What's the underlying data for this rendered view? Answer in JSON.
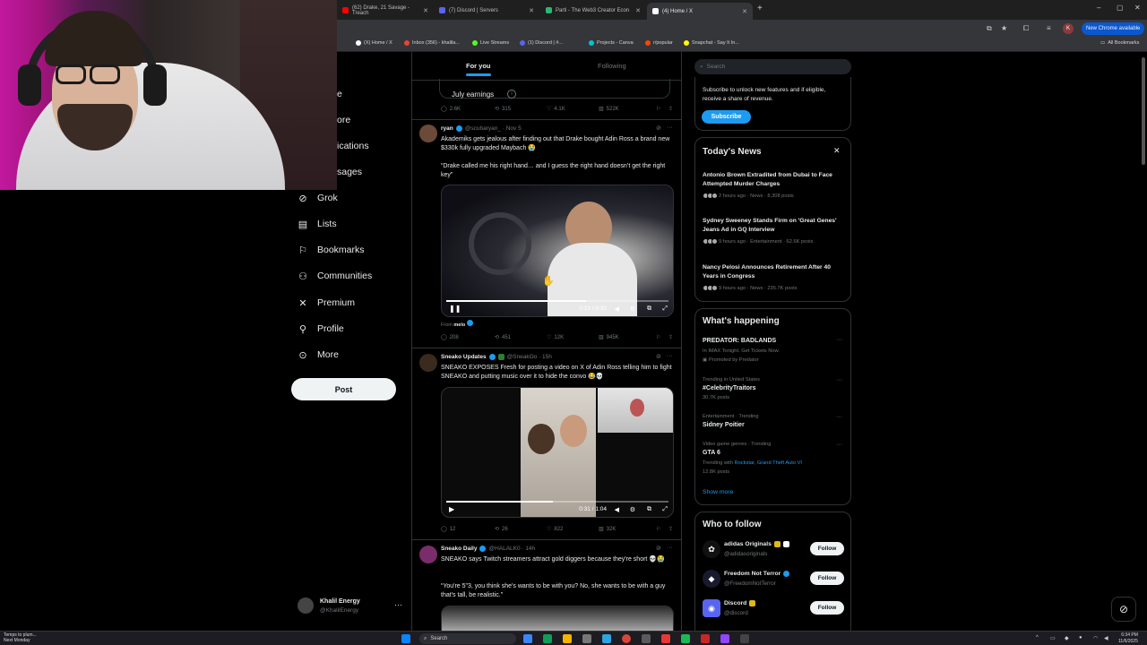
{
  "browser": {
    "tabs": [
      {
        "label": "(62) Drake, 21 Savage - Treach",
        "color": "#ff0000"
      },
      {
        "label": "(7) Discord | Servers",
        "color": "#5865f2"
      },
      {
        "label": "Parti - The Web3 Creator Econ",
        "color": "#2bb673"
      },
      {
        "label": "(4) Home / X",
        "color": "#ffffff"
      }
    ],
    "new_chrome": "New Chrome available",
    "profile_initial": "K",
    "bookmarks": [
      {
        "label": "",
        "color": "#888"
      },
      {
        "label": "(X) Home / X",
        "color": "#ffffff"
      },
      {
        "label": "Inbox (356) - khalila...",
        "color": "#ea4335"
      },
      {
        "label": "Live Streams",
        "color": "#53fc18"
      },
      {
        "label": "(1) Discord | #...",
        "color": "#5865f2"
      },
      {
        "label": "Projects - Canva",
        "color": "#00c4cc"
      },
      {
        "label": "r/popular",
        "color": "#ff4500"
      },
      {
        "label": "Snapchat - Say It In...",
        "color": "#fffc00"
      }
    ],
    "all_bookmarks": "All Bookmarks"
  },
  "nav": {
    "partials": [
      "e",
      "ore",
      "ications",
      "sages"
    ],
    "items": [
      {
        "label": "Grok",
        "icon": "grok-icon",
        "glyph": "⊘"
      },
      {
        "label": "Lists",
        "icon": "list-icon",
        "glyph": "▤"
      },
      {
        "label": "Bookmarks",
        "icon": "bookmark-icon",
        "glyph": "⚐"
      },
      {
        "label": "Communities",
        "icon": "communities-icon",
        "glyph": "⚇"
      },
      {
        "label": "Premium",
        "icon": "x-logo-icon",
        "glyph": "✕"
      },
      {
        "label": "Profile",
        "icon": "profile-icon",
        "glyph": "⚲"
      },
      {
        "label": "More",
        "icon": "more-icon",
        "glyph": "⊙"
      }
    ],
    "post_label": "Post",
    "account": {
      "name": "Khalil Energy",
      "handle": "@KhalilEnergy"
    }
  },
  "feed": {
    "tabs": {
      "for_you": "For you",
      "following": "Following"
    },
    "earnings": {
      "label": "July earnings",
      "replies": "2.6K",
      "reposts": "315",
      "likes": "4.1K",
      "views": "522K"
    },
    "posts": [
      {
        "name": "ryan",
        "handle": "@scubaryan_ · Nov 5",
        "text": "Akademiks gets jealous after finding out that Drake bought Adin Ross a brand new $330k fully upgraded Maybach 😭",
        "quote": "“Drake called me his right hand… and I guess the right hand doesn’t get the right key”",
        "video_time": "0:19 / 0:30",
        "progress": 0.63,
        "from_label": "From",
        "from_name": "melo",
        "replies": "208",
        "reposts": "451",
        "likes": "12K",
        "views": "945K"
      },
      {
        "name": "Sneako Updates",
        "handle": "@SneakOo · 15h",
        "text": "SNEAKO EXPOSES Fresh for posting a video on X of Adin Ross telling him to fight SNEAKO and putting music over it to hide the convo 😂💀",
        "video_time": "0:31 / 1:04",
        "progress": 0.48,
        "replies": "12",
        "reposts": "26",
        "likes": "822",
        "views": "32K"
      },
      {
        "name": "Sneako Daily",
        "handle": "@HALALK0 · 14h",
        "text": "SNEAKO says Twitch streamers attract gold diggers because they're short 💀😭",
        "quote": "“You're 5\"3, you think she's wants to be with you? No, she wants to be with a guy that's tall, be realistic.”"
      }
    ]
  },
  "right": {
    "search_placeholder": "Search",
    "subscribe": {
      "text": "Subscribe to unlock new features and if eligible, receive a share of revenue.",
      "button": "Subscribe"
    },
    "news_title": "Today's News",
    "news": [
      {
        "title": "Antonio Brown Extradited from Dubai to Face Attempted Murder Charges",
        "meta": "2 hours ago · News · 8,308 posts"
      },
      {
        "title": "Sydney Sweeney Stands Firm on 'Great Genes' Jeans Ad in GQ Interview",
        "meta": "9 hours ago · Entertainment · 62.6K posts"
      },
      {
        "title": "Nancy Pelosi Announces Retirement After 40 Years in Congress",
        "meta": "9 hours ago · News · 235.7K posts"
      }
    ],
    "happening_title": "What's happening",
    "trends": [
      {
        "context": "",
        "name": "PREDATOR: BADLANDS",
        "sub": "In IMAX Tonight. Get Tickets Now.",
        "promo": "Promoted by Predator"
      },
      {
        "context": "Trending in United States",
        "name": "#CelebrityTraitors",
        "sub": "30.7K posts"
      },
      {
        "context": "Entertainment · Trending",
        "name": "Sidney Poitier",
        "sub": ""
      },
      {
        "context": "Video game genres · Trending",
        "name": "GTA 6",
        "sub_prefix": "Trending with",
        "sub_link": "Rockstar, Grand Theft Auto VI",
        "sub": "12.8K posts"
      }
    ],
    "show_more": "Show more",
    "wtf_title": "Who to follow",
    "follow": [
      {
        "name": "adidas Originals",
        "handle": "@adidasoriginals",
        "bg": "#111111",
        "glyph": "✿"
      },
      {
        "name": "Freedom Not Terror",
        "handle": "@FreedomNotTerror",
        "bg": "#1a1a2e",
        "glyph": "◆"
      },
      {
        "name": "Discord",
        "handle": "@discord",
        "bg": "#5865f2",
        "glyph": "◉"
      }
    ],
    "follow_label": "Follow"
  },
  "taskbar": {
    "weather": "Temps to plum...",
    "weather_sub": "Next Monday",
    "search": "Search",
    "time": "6:34 PM",
    "date": "11/6/2025"
  }
}
